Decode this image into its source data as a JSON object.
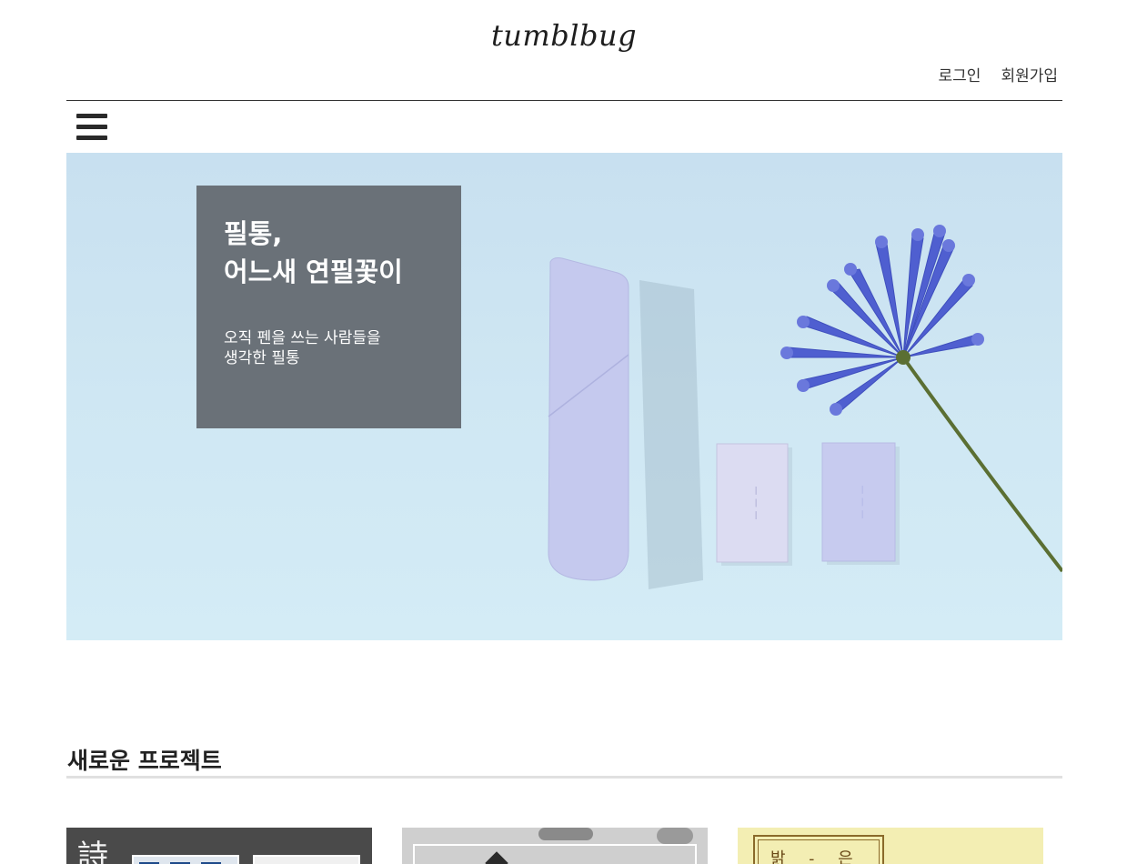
{
  "header": {
    "logo": "tumblbug",
    "login_label": "로그인",
    "signup_label": "회원가입"
  },
  "hero": {
    "title_line1": "필통,",
    "title_line2": "어느새 연필꽃이",
    "desc_line1": "오직 펜을 쓰는 사람들을",
    "desc_line2": "생각한 필통"
  },
  "section": {
    "title": "새로운 프로젝트"
  },
  "cards": [
    {
      "thumb_text": "詩"
    },
    {
      "thumb_text": ""
    },
    {
      "thumb_text": "밝 - 은"
    }
  ],
  "colors": {
    "hero_box": "#6a7178",
    "hero_bg": "#cfe7f3",
    "card3_bg": "#f3eeb3"
  }
}
